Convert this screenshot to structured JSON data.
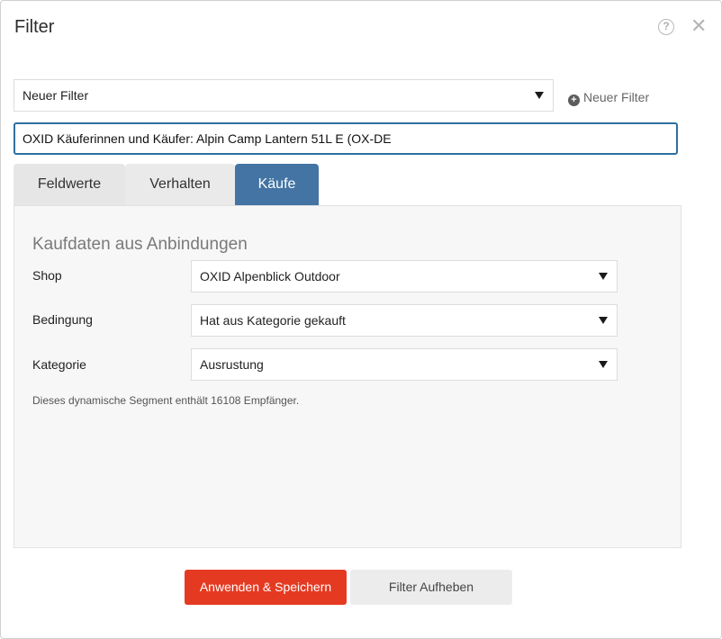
{
  "dialog": {
    "title": "Filter"
  },
  "filter_select": {
    "value": "Neuer Filter"
  },
  "new_filter_button": {
    "label": "Neuer Filter"
  },
  "name_input": {
    "value": "OXID Käuferinnen und Käufer: Alpin Camp Lantern 51L E (OX-DE"
  },
  "tabs": [
    {
      "label": "Feldwerte",
      "active": false
    },
    {
      "label": "Verhalten",
      "active": false
    },
    {
      "label": "Käufe",
      "active": true
    }
  ],
  "panel": {
    "section_title": "Kaufdaten aus Anbindungen",
    "fields": [
      {
        "label": "Shop",
        "value": "OXID Alpenblick Outdoor"
      },
      {
        "label": "Bedingung",
        "value": "Hat aus Kategorie gekauft"
      },
      {
        "label": "Kategorie",
        "value": "Ausrustung"
      }
    ],
    "info": "Dieses dynamische Segment enthält 16108 Empfänger."
  },
  "buttons": {
    "apply": "Anwenden & Speichern",
    "reset": "Filter Aufheben"
  },
  "colors": {
    "active_tab": "#4374a3",
    "apply_button": "#e53a22",
    "input_border": "#2f6f9f"
  },
  "icons": {
    "help": "question-circle-icon",
    "close": "close-icon",
    "add": "plus-circle-icon",
    "dropdown": "caret-down-icon"
  }
}
